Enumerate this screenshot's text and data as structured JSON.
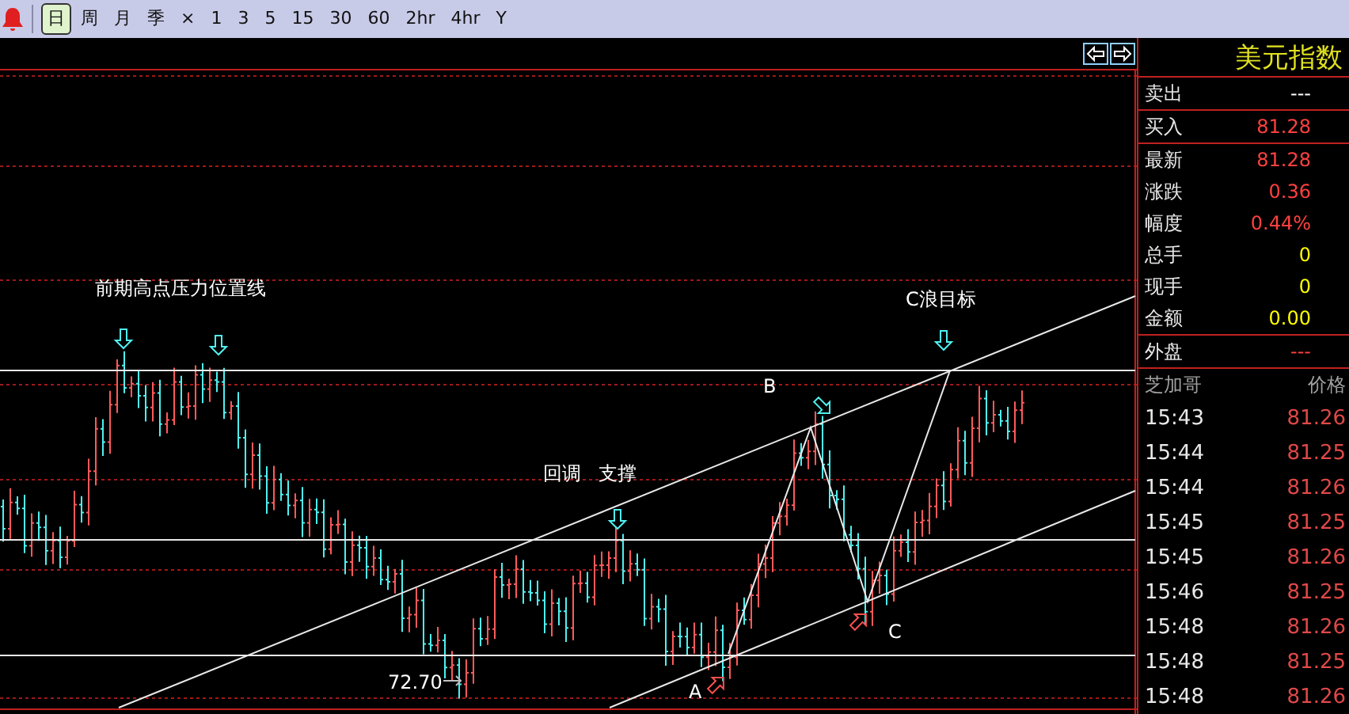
{
  "toolbar": {
    "periods": [
      {
        "label": "日",
        "selected": true
      },
      {
        "label": "周",
        "selected": false
      },
      {
        "label": "月",
        "selected": false
      },
      {
        "label": "季",
        "selected": false
      },
      {
        "label": "×",
        "selected": false
      },
      {
        "label": "1",
        "selected": false
      },
      {
        "label": "3",
        "selected": false
      },
      {
        "label": "5",
        "selected": false
      },
      {
        "label": "15",
        "selected": false
      },
      {
        "label": "30",
        "selected": false
      },
      {
        "label": "60",
        "selected": false
      },
      {
        "label": "2hr",
        "selected": false
      },
      {
        "label": "4hr",
        "selected": false
      },
      {
        "label": "Y",
        "selected": false
      }
    ]
  },
  "chart": {
    "annotations": [
      {
        "text": "前期高点压力位置线"
      },
      {
        "text": "C浪目标"
      },
      {
        "text": "回调"
      },
      {
        "text": "支撑"
      },
      {
        "text": "B"
      },
      {
        "text": "A"
      },
      {
        "text": "C"
      },
      {
        "text": "72.70"
      }
    ]
  },
  "quote": {
    "title": "美元指数",
    "rows": [
      {
        "label": "卖出",
        "value": "---",
        "color": "#ffffff"
      },
      {
        "label": "买入",
        "value": "81.28",
        "color": "#ff4040"
      },
      {
        "label": "最新",
        "value": "81.28",
        "color": "#ff4040"
      },
      {
        "label": "涨跌",
        "value": "0.36",
        "color": "#ff4040"
      },
      {
        "label": "幅度",
        "value": "0.44%",
        "color": "#ff4040"
      },
      {
        "label": "总手",
        "value": "0",
        "color": "#ffff00"
      },
      {
        "label": "现手",
        "value": "0",
        "color": "#ffff00"
      },
      {
        "label": "金额",
        "value": "0.00",
        "color": "#ffff00"
      },
      {
        "label": "外盘",
        "value": "---",
        "color": "#ff4040"
      }
    ]
  },
  "trades": {
    "columns": [
      "芝加哥",
      "价格"
    ],
    "rows": [
      {
        "time": "15:43",
        "price": "81.26"
      },
      {
        "time": "15:44",
        "price": "81.25"
      },
      {
        "time": "15:44",
        "price": "81.26"
      },
      {
        "time": "15:45",
        "price": "81.25"
      },
      {
        "time": "15:45",
        "price": "81.26"
      },
      {
        "time": "15:46",
        "price": "81.25"
      },
      {
        "time": "15:48",
        "price": "81.26"
      },
      {
        "time": "15:48",
        "price": "81.25"
      },
      {
        "time": "15:48",
        "price": "81.26"
      }
    ]
  }
}
